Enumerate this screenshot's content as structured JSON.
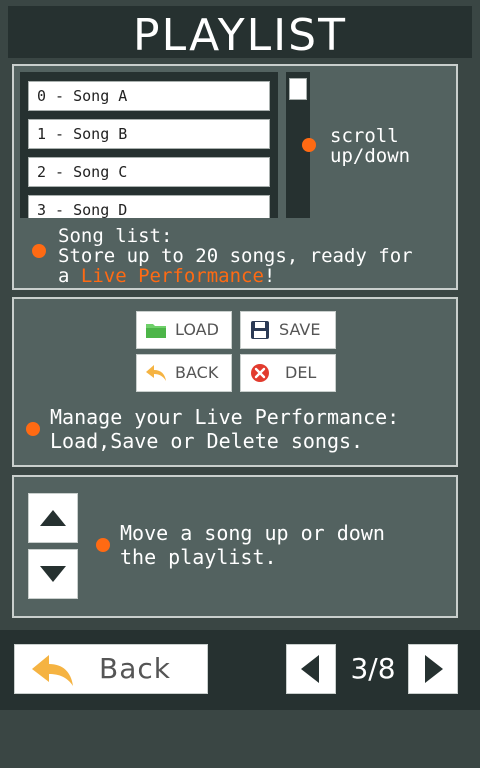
{
  "header": {
    "title": "PLAYLIST"
  },
  "song_list": {
    "items": [
      "0 - Song A",
      "1 - Song B",
      "2 - Song C",
      "3 - Song D"
    ]
  },
  "scroll_note": "scroll\nup/down",
  "song_list_note": {
    "line1": "Song list:",
    "line2": "Store up to 20 songs, ready for",
    "line3_prefix": "a ",
    "line3_highlight": "Live Performance",
    "line3_suffix": "!"
  },
  "manage": {
    "load_label": "LOAD",
    "save_label": "SAVE",
    "back_label": "BACK",
    "del_label": "DEL",
    "note": "Manage your Live Performance:\nLoad,Save or Delete songs."
  },
  "move_note": "Move a song up or down\nthe playlist.",
  "footer": {
    "back_label": "Back",
    "page_indicator": "3/8"
  },
  "colors": {
    "accent": "#ff6a13",
    "panel": "#536260",
    "dark": "#263130",
    "background": "#3a4644"
  }
}
